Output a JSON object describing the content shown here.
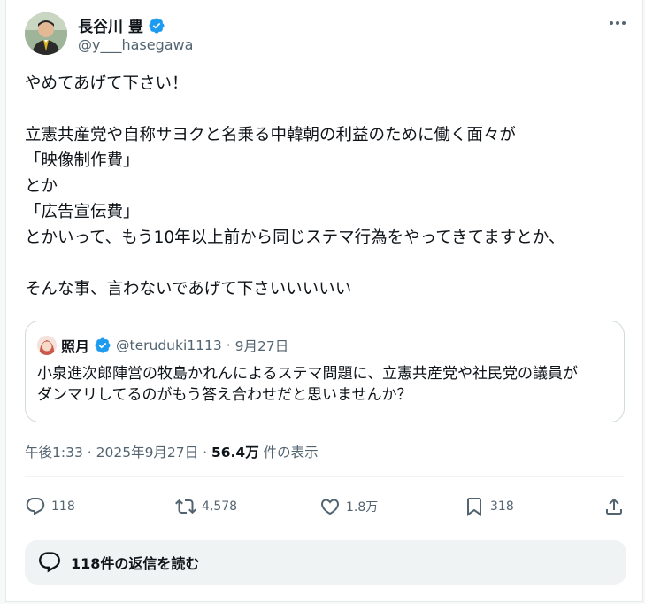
{
  "author": {
    "display_name": "長谷川 豊",
    "handle": "@y___hasegawa"
  },
  "tweet": {
    "lines": [
      "やめてあげて下さい！",
      "",
      "立憲共産党や自称サヨクと名乗る中韓朝の利益のために働く面々が",
      "「映像制作費」",
      "とか",
      "「広告宣伝費」",
      "とかいって、もう10年以上前から同じステマ行為をやってきてますとか、",
      "",
      "そんな事、言わないであげて下さいいいいい"
    ]
  },
  "quote": {
    "display_name": "照月",
    "handle": "@teruduki1113",
    "separator": "·",
    "date": "9月27日",
    "lines": [
      "小泉進次郎陣営の牧島かれんによるステマ問題に、立憲共産党や社民党の議員が",
      "ダンマリしてるのがもう答え合わせだと思いませんか？"
    ]
  },
  "meta": {
    "time": "午後1:33",
    "sep1": "·",
    "date": "2025年9月27日",
    "sep2": "·",
    "views": "56.4万",
    "views_label": "件の表示"
  },
  "actions": {
    "replies": "118",
    "reposts": "4,578",
    "likes": "1.8万",
    "bookmarks": "318"
  },
  "read_replies_label": "118件の返信を読む",
  "colors": {
    "verified": "#1d9bf0",
    "secondary_text": "#536471",
    "primary_text": "#0f1419"
  },
  "icons": {
    "more": "more-horizontal-icon",
    "verified": "verified-badge-icon",
    "reply": "reply-icon",
    "repost": "repost-icon",
    "like": "heart-icon",
    "bookmark": "bookmark-icon",
    "share": "share-icon",
    "read_replies": "speech-bubble-icon"
  }
}
